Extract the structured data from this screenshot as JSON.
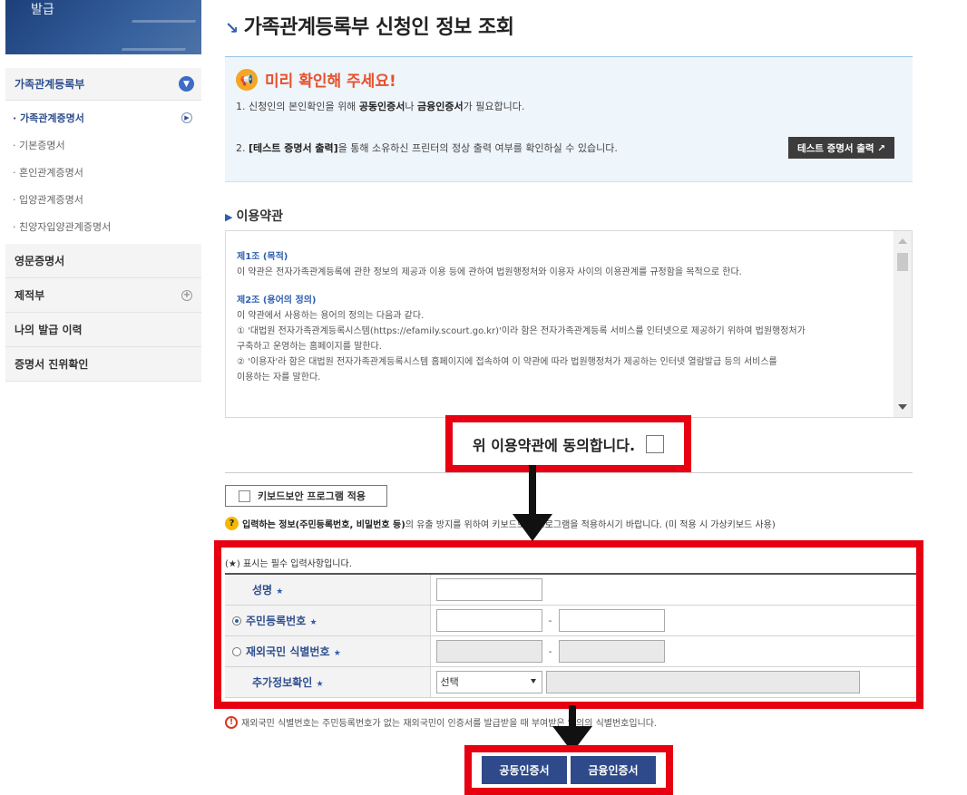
{
  "banner": {
    "text": "발급"
  },
  "sidebar": {
    "header": {
      "label": "가족관계등록부"
    },
    "sub_items": [
      {
        "label": "· 가족관계증명서",
        "active": true
      },
      {
        "label": "· 기본증명서"
      },
      {
        "label": "· 혼인관계증명서"
      },
      {
        "label": "· 입양관계증명서"
      },
      {
        "label": "· 친양자입양관계증명서"
      }
    ],
    "items": [
      {
        "label": "영문증명서"
      },
      {
        "label": "제적부"
      },
      {
        "label": "나의 발급 이력"
      },
      {
        "label": "증명서 진위확인"
      }
    ]
  },
  "page": {
    "title": "가족관계등록부 신청인 정보 조회"
  },
  "notice": {
    "heading": "미리 확인해 주세요!",
    "line1": {
      "pre": "1. 신청인의 본인확인을 위해 ",
      "b1": "공동인증서",
      "mid": "나 ",
      "b2": "금융인증서",
      "post": "가 필요합니다."
    },
    "line2": {
      "pre": "2. ",
      "b1": "[테스트 증명서 출력]",
      "post": "을 통해 소유하신 프린터의 정상 출력 여부를 확인하실 수 있습니다."
    },
    "test_button": "테스트 증명서 출력 ↗"
  },
  "terms": {
    "label": "이용약관",
    "sections": [
      {
        "heading": "제1조 (목적)",
        "lines": [
          "이 약관은 전자가족관계등록에 관한 정보의 제공과 이용 등에 관하여 법원행정처와 이용자 사이의 이용관계를 규정함을 목적으로 한다."
        ]
      },
      {
        "heading": "제2조 (용어의 정의)",
        "lines": [
          "이 약관에서 사용하는 용어의 정의는 다음과 같다.",
          "① '대법원 전자가족관계등록시스템(https://efamily.scourt.go.kr)'이라 함은 전자가족관계등록 서비스를 인터넷으로 제공하기 위하여 법원행정처가",
          "구축하고 운영하는 홈페이지를 말한다.",
          "② '이용자'라 함은 대법원 전자가족관계등록시스템 홈페이지에 접속하여 이 약관에 따라 법원행정처가 제공하는 인터넷 열람발급 등의 서비스를",
          "이용하는 자를 말한다."
        ]
      }
    ],
    "agree_label": "위 이용약관에 동의합니다."
  },
  "keyboard": {
    "button_label": "키보드보안 프로그램 적용",
    "note_bold": "입력하는 정보(주민등록번호, 비밀번호 등)",
    "note_rest": "의 유출 방지를 위하여 키보드보안 프로그램을 적용하시기 바랍니다. (미 적용 시 가상키보드 사용)"
  },
  "form": {
    "required_note": "(★) 표시는 필수 입력사항입니다.",
    "rows": [
      {
        "label": "성명"
      },
      {
        "label": "주민등록번호",
        "radio": "on"
      },
      {
        "label": "재외국민 식별번호",
        "radio": "off"
      },
      {
        "label": "추가정보확인"
      }
    ],
    "select_value": "선택",
    "dash": "-",
    "star": "★"
  },
  "warning": "재외국민 식별번호는 주민등록번호가 없는 재외국민이 인증서를 발급받을 때 부여받은 임의의 식별번호입니다.",
  "buttons": {
    "joint": "공동인증서",
    "finance": "금융인증서"
  },
  "colors": {
    "highlight": "#e60012",
    "accent": "#2d5fb0",
    "button": "#2e4a8a"
  }
}
